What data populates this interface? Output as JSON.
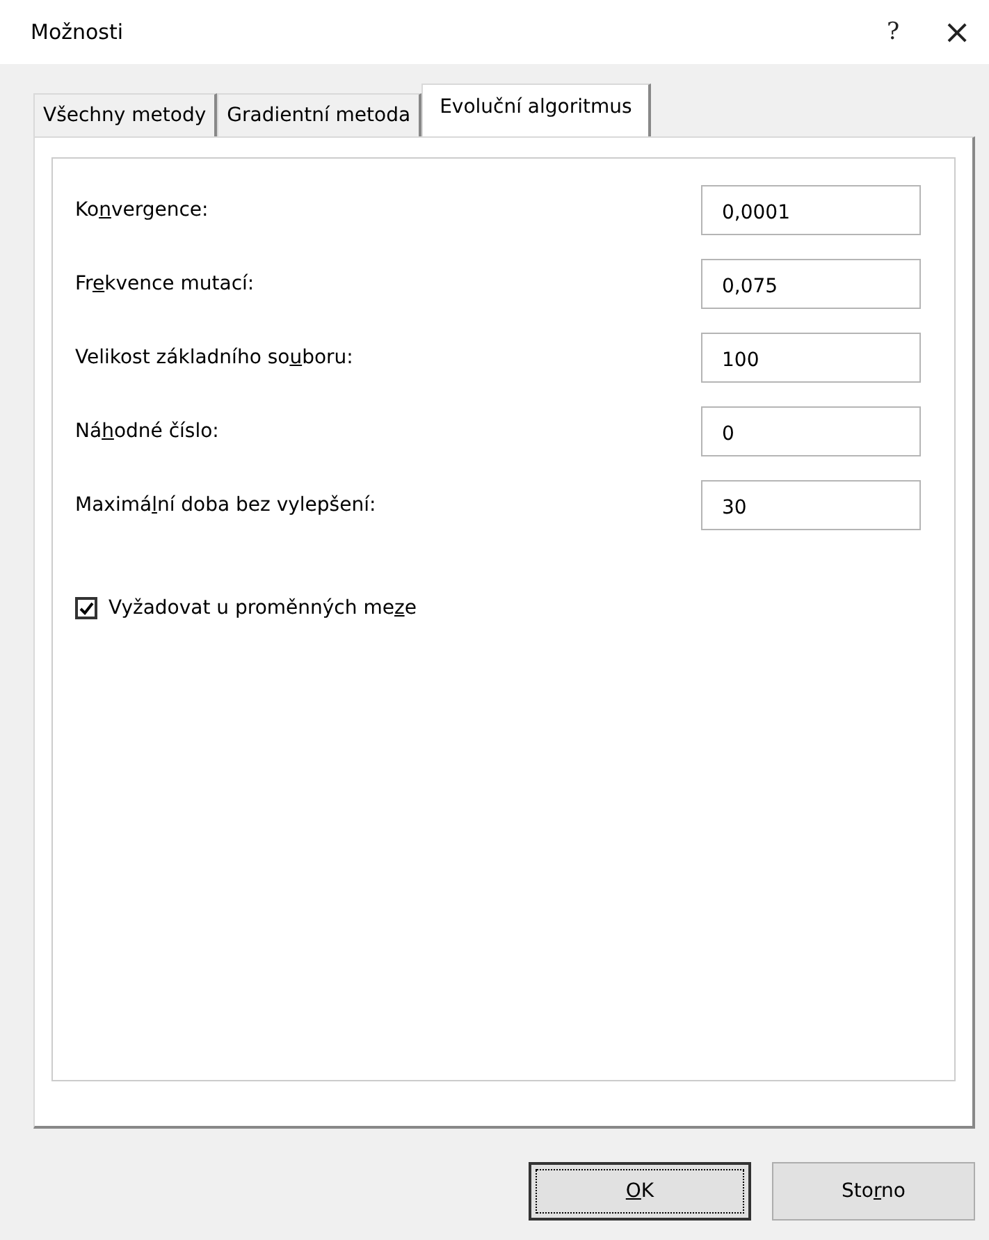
{
  "window": {
    "title": "Možnosti",
    "help": "?",
    "close": "×"
  },
  "tabs": [
    {
      "label": "Všechny metody",
      "selected": false
    },
    {
      "label": "Gradientní metoda",
      "selected": false
    },
    {
      "label": "Evoluční algoritmus",
      "selected": true
    }
  ],
  "fields": [
    {
      "label": {
        "before": "Ko",
        "key": "n",
        "after": "vergence:"
      },
      "value": "0,0001"
    },
    {
      "label": {
        "before": "Fr",
        "key": "e",
        "after": "kvence mutací:"
      },
      "value": "0,075"
    },
    {
      "label": {
        "before": "Velikost základního so",
        "key": "u",
        "after": "boru:"
      },
      "value": "100"
    },
    {
      "label": {
        "before": "Ná",
        "key": "h",
        "after": "odné číslo:"
      },
      "value": "0"
    },
    {
      "label": {
        "before": "Maximá",
        "key": "l",
        "after": "ní doba bez vylepšení:"
      },
      "value": "30"
    }
  ],
  "checkbox": {
    "label": {
      "before": "Vyžadovat u proměnných me",
      "key": "z",
      "after": "e"
    },
    "checked": true
  },
  "buttons": [
    {
      "label": {
        "key": "O",
        "after": "K"
      },
      "default": true
    },
    {
      "label": {
        "before": "Sto",
        "key": "r",
        "after": "no"
      },
      "default": false
    }
  ]
}
